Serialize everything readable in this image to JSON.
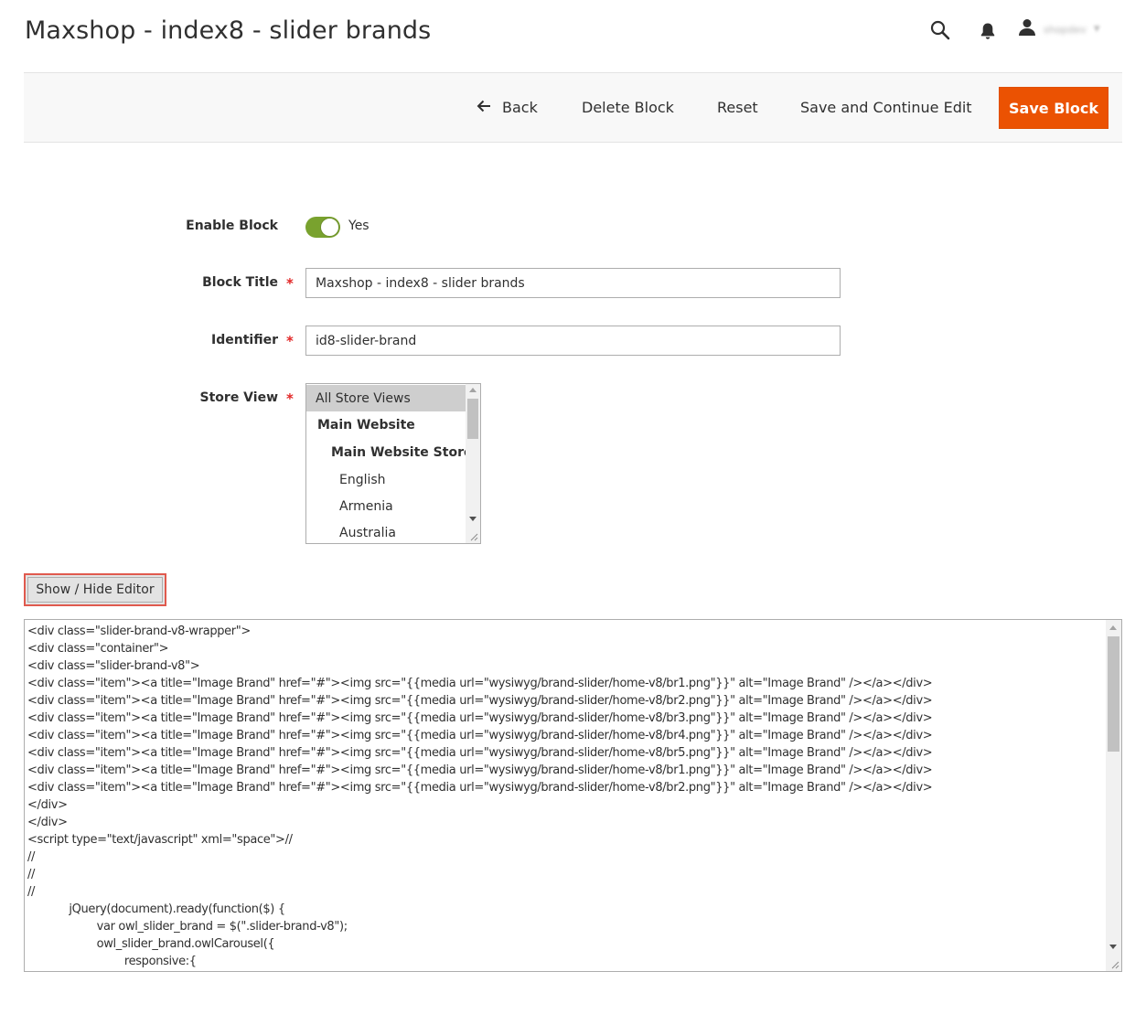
{
  "page": {
    "title": "Maxshop - index8 - slider brands"
  },
  "header": {
    "icons": [
      "search-icon",
      "notifications-icon",
      "user-icon"
    ],
    "user_name": "shopdev",
    "user_caret": "▼"
  },
  "toolbar": {
    "back_label": "Back",
    "delete_label": "Delete Block",
    "reset_label": "Reset",
    "save_continue_label": "Save and Continue Edit",
    "save_label": "Save Block"
  },
  "form": {
    "enable": {
      "label": "Enable Block",
      "value_text": "Yes",
      "enabled": true
    },
    "title": {
      "label": "Block Title",
      "value": "Maxshop - index8 - slider brands"
    },
    "identifier": {
      "label": "Identifier",
      "value": "id8-slider-brand"
    },
    "store_view": {
      "label": "Store View",
      "options": [
        {
          "label": "All Store Views",
          "selected": true
        },
        {
          "label": "Main Website",
          "bold": true
        },
        {
          "label": "Main Website Store",
          "bold": true
        },
        {
          "label": "English"
        },
        {
          "label": "Armenia"
        },
        {
          "label": "Australia"
        }
      ]
    },
    "required_mark": "*"
  },
  "editor": {
    "toggle_label": "Show / Hide Editor",
    "lines": [
      "<div class=\"slider-brand-v8-wrapper\">",
      "<div class=\"container\">",
      "<div class=\"slider-brand-v8\">",
      "<div class=\"item\"><a title=\"Image Brand\" href=\"#\"><img src=\"{{media url=\"wysiwyg/brand-slider/home-v8/br1.png\"}}\" alt=\"Image Brand\" /></a></div>",
      "<div class=\"item\"><a title=\"Image Brand\" href=\"#\"><img src=\"{{media url=\"wysiwyg/brand-slider/home-v8/br2.png\"}}\" alt=\"Image Brand\" /></a></div>",
      "<div class=\"item\"><a title=\"Image Brand\" href=\"#\"><img src=\"{{media url=\"wysiwyg/brand-slider/home-v8/br3.png\"}}\" alt=\"Image Brand\" /></a></div>",
      "<div class=\"item\"><a title=\"Image Brand\" href=\"#\"><img src=\"{{media url=\"wysiwyg/brand-slider/home-v8/br4.png\"}}\" alt=\"Image Brand\" /></a></div>",
      "<div class=\"item\"><a title=\"Image Brand\" href=\"#\"><img src=\"{{media url=\"wysiwyg/brand-slider/home-v8/br5.png\"}}\" alt=\"Image Brand\" /></a></div>",
      "<div class=\"item\"><a title=\"Image Brand\" href=\"#\"><img src=\"{{media url=\"wysiwyg/brand-slider/home-v8/br1.png\"}}\" alt=\"Image Brand\" /></a></div>",
      "<div class=\"item\"><a title=\"Image Brand\" href=\"#\"><img src=\"{{media url=\"wysiwyg/brand-slider/home-v8/br2.png\"}}\" alt=\"Image Brand\" /></a></div>",
      "</div>",
      "</div>",
      "<script type=\"text/javascript\" xml=\"space\">//",
      "//",
      "//",
      "//",
      "            jQuery(document).ready(function($) {",
      "                    var owl_slider_brand = $(\".slider-brand-v8\");",
      "                    owl_slider_brand.owlCarousel({",
      "                            responsive:{"
    ]
  },
  "colors": {
    "accent": "#eb5202",
    "toggle_on": "#79a22e",
    "required": "#e22626",
    "highlight_border": "#e05a4e"
  }
}
